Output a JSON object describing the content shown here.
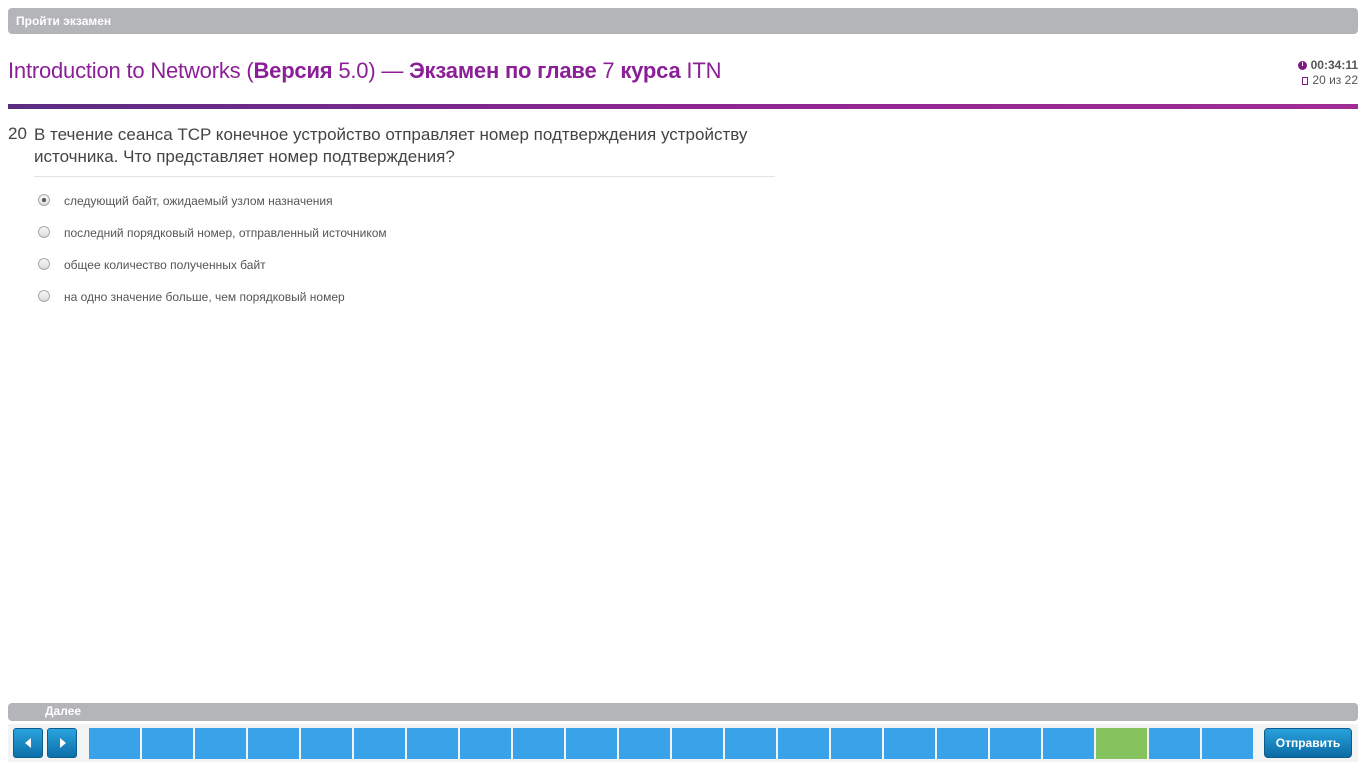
{
  "header": {
    "bar_label": "Пройти экзамен"
  },
  "exam": {
    "title_part1": "Introduction to Networks (",
    "title_part2": "Версия",
    "title_part3": " 5.0) — ",
    "title_part4": "Экзамен по главе",
    "title_part5": " 7 ",
    "title_part6": "курса",
    "title_part7": " ITN",
    "timer": "00:34:11",
    "progress": "20 из 22"
  },
  "question": {
    "number": "20",
    "text": "В течение сеанса TCP конечное устройство отправляет номер подтверждения устройству источника. Что представляет номер подтверждения?",
    "options": [
      {
        "label": "следующий байт, ожидаемый узлом назначения",
        "selected": true
      },
      {
        "label": "последний порядковый номер, отправленный источником",
        "selected": false
      },
      {
        "label": "общее количество полученных байт",
        "selected": false
      },
      {
        "label": "на одно значение больше, чем порядковый номер",
        "selected": false
      }
    ]
  },
  "footer": {
    "bar_label": "Далее",
    "submit_label": "Отправить",
    "current_question": 20,
    "total_questions": 22,
    "colors": {
      "answered": "#38a3e9",
      "current": "#84c35e",
      "accent": "#8b1f97"
    }
  }
}
